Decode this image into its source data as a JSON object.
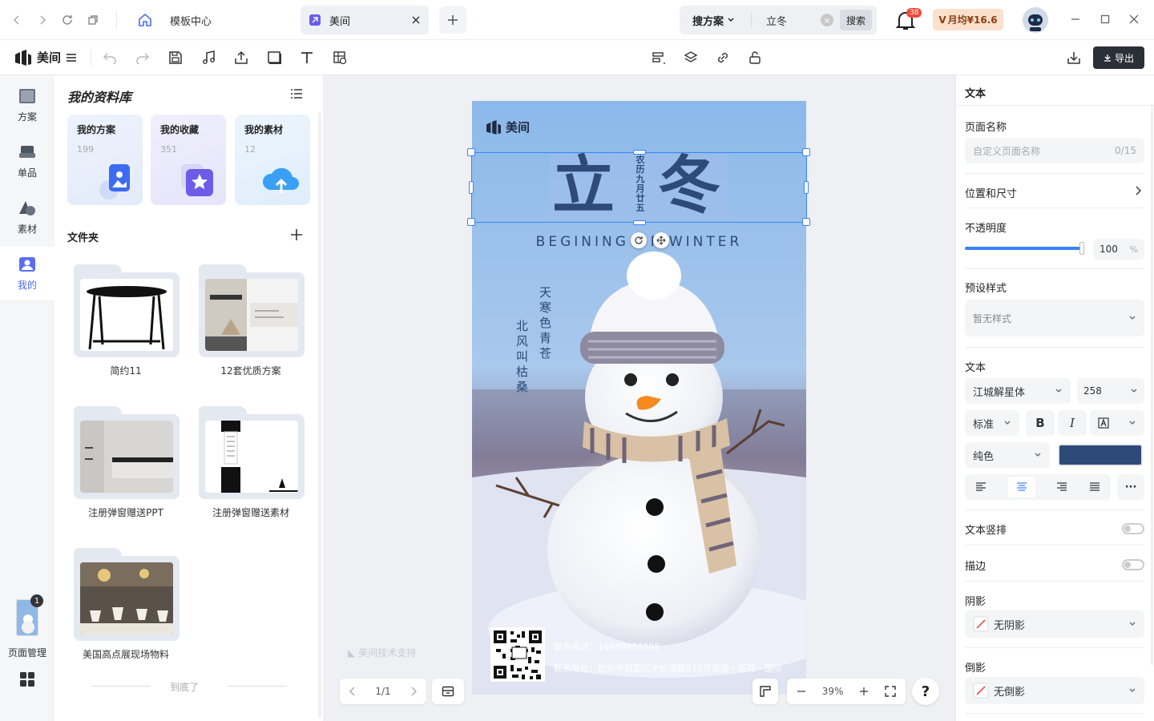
{
  "topbar": {
    "home_tab_label": "模板中心",
    "doc_tab_label": "美间",
    "search_scope": "搜方案",
    "search_value": "立冬",
    "search_button": "搜索",
    "notification_count": "38",
    "vip_label": "月均¥16.6"
  },
  "toolbar": {
    "brand": "美间",
    "export_label": "导出"
  },
  "rail": {
    "items": [
      {
        "label": "方案"
      },
      {
        "label": "单品"
      },
      {
        "label": "素材"
      },
      {
        "label": "我的"
      }
    ],
    "page_manage_label": "页面管理",
    "page_count": "1"
  },
  "library": {
    "title": "我的资料库",
    "cards": [
      {
        "title": "我的方案",
        "count": "199"
      },
      {
        "title": "我的收藏",
        "count": "351"
      },
      {
        "title": "我的素材",
        "count": "12"
      }
    ],
    "folder_section": "文件夹",
    "folders": [
      {
        "label": "简约11"
      },
      {
        "label": "12套优质方案"
      },
      {
        "label": "注册弹窗赠送PPT"
      },
      {
        "label": "注册弹窗赠送素材"
      },
      {
        "label": "美国高点展现场物料"
      }
    ],
    "end_label": "到底了"
  },
  "poster": {
    "brand": "美间",
    "title_left": "立",
    "title_right": "冬",
    "lunar_date": "农历九月廿五",
    "subtitle": "BEGINING OF WINTER",
    "poem_line1": "天寒色青苍",
    "poem_line2": "北风叫枯桑",
    "phone": "联系电话：16888888888",
    "address": "联系地址：杭州市拱墅区余杭塘路515号莱茵・矩阵・国际"
  },
  "canvas": {
    "watermark": "美间技术支持",
    "page_indicator": "1/1",
    "zoom": "39%"
  },
  "props": {
    "panel_title": "文本",
    "page_name_label": "页面名称",
    "page_name_placeholder": "自定义页面名称",
    "page_name_counter": "0/15",
    "position_size_label": "位置和尺寸",
    "opacity_label": "不透明度",
    "opacity_value": "100",
    "opacity_unit": "%",
    "opacity_fraction": 1.0,
    "preset_label": "预设样式",
    "preset_value": "暂无样式",
    "text_label": "文本",
    "font_family": "江城解星体",
    "font_size": "258",
    "weight": "标准",
    "fill_type": "纯色",
    "text_color": "#2d4a78",
    "vertical_label": "文本竖排",
    "stroke_label": "描边",
    "shadow_label": "阴影",
    "shadow_value": "无阴影",
    "reflection_label": "倒影",
    "reflection_value": "无倒影"
  }
}
